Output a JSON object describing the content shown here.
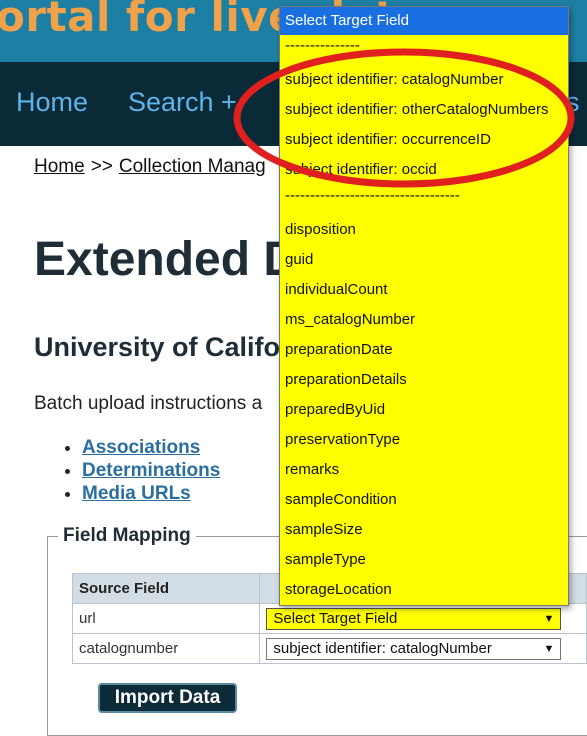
{
  "banner": {
    "title": "ortal for live-data"
  },
  "nav": {
    "home": "Home",
    "search": "Search +",
    "extra": "s"
  },
  "breadcrumb": {
    "home": "Home",
    "separator": ">>",
    "current": "Collection Manag"
  },
  "page": {
    "title": "Extended D",
    "subtitle": "University of Califo",
    "instructions": "Batch upload instructions a"
  },
  "links": [
    "Associations",
    "Determinations",
    "Media URLs"
  ],
  "field_mapping": {
    "legend": "Field Mapping",
    "headers": [
      "Source Field",
      ""
    ],
    "rows": [
      {
        "source": "url",
        "target": "Select Target Field"
      },
      {
        "source": "catalognumber",
        "target": "subject identifier: catalogNumber"
      }
    ],
    "import_label": "Import Data"
  },
  "dropdown": {
    "selected": "Select Target Field",
    "options": [
      "---------------",
      "subject identifier: catalogNumber",
      "subject identifier: otherCatalogNumbers",
      "subject identifier: occurrenceID",
      "subject identifier: occid",
      "-----------------------------------",
      "disposition",
      "guid",
      "individualCount",
      "ms_catalogNumber",
      "preparationDate",
      "preparationDetails",
      "preparedByUid",
      "preservationType",
      "remarks",
      "sampleCondition",
      "sampleSize",
      "sampleType",
      "storageLocation"
    ]
  },
  "colors": {
    "banner": "#1d7fa3",
    "banner_text": "#f0a24a",
    "navbar": "#0b2a38",
    "nav_link": "#5fb3e8",
    "dropdown_bg": "#ffff00",
    "dropdown_selected": "#1a6fe0",
    "annotation": "#e0201f"
  }
}
